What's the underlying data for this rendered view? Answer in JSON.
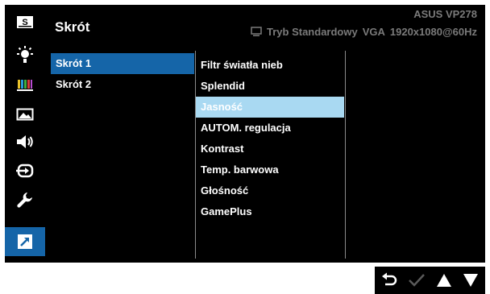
{
  "header": {
    "title": "Skrót",
    "model": "ASUS  VP278",
    "mode": "Tryb Standardowy",
    "input": "VGA",
    "resolution": "1920x1080@60Hz"
  },
  "sidebar": {
    "items": [
      {
        "icon": "s-logo-icon"
      },
      {
        "icon": "brightness-sun-icon"
      },
      {
        "icon": "color-bars-icon"
      },
      {
        "icon": "image-landscape-icon"
      },
      {
        "icon": "speaker-volume-icon"
      },
      {
        "icon": "input-select-icon"
      },
      {
        "icon": "wrench-icon"
      },
      {
        "icon": "shortcut-arrow-icon",
        "active": true
      }
    ]
  },
  "menu": {
    "level1": [
      {
        "label": "Skrót 1",
        "selected": true
      },
      {
        "label": "Skrót 2",
        "selected": false
      }
    ],
    "level2": [
      {
        "label": "Filtr światła nieb"
      },
      {
        "label": "Splendid"
      },
      {
        "label": "Jasność",
        "highlighted": true
      },
      {
        "label": "AUTOM. regulacja"
      },
      {
        "label": "Kontrast"
      },
      {
        "label": "Temp. barwowa"
      },
      {
        "label": "Głośność"
      },
      {
        "label": "GamePlus"
      }
    ]
  },
  "nav_buttons": [
    {
      "icon": "back-icon"
    },
    {
      "icon": "check-icon",
      "disabled": true
    },
    {
      "icon": "up-arrow-icon"
    },
    {
      "icon": "down-arrow-icon"
    }
  ],
  "colors": {
    "accent": "#1565a8",
    "highlight": "#a9d9f2",
    "muted_text": "#7a7a7a"
  }
}
